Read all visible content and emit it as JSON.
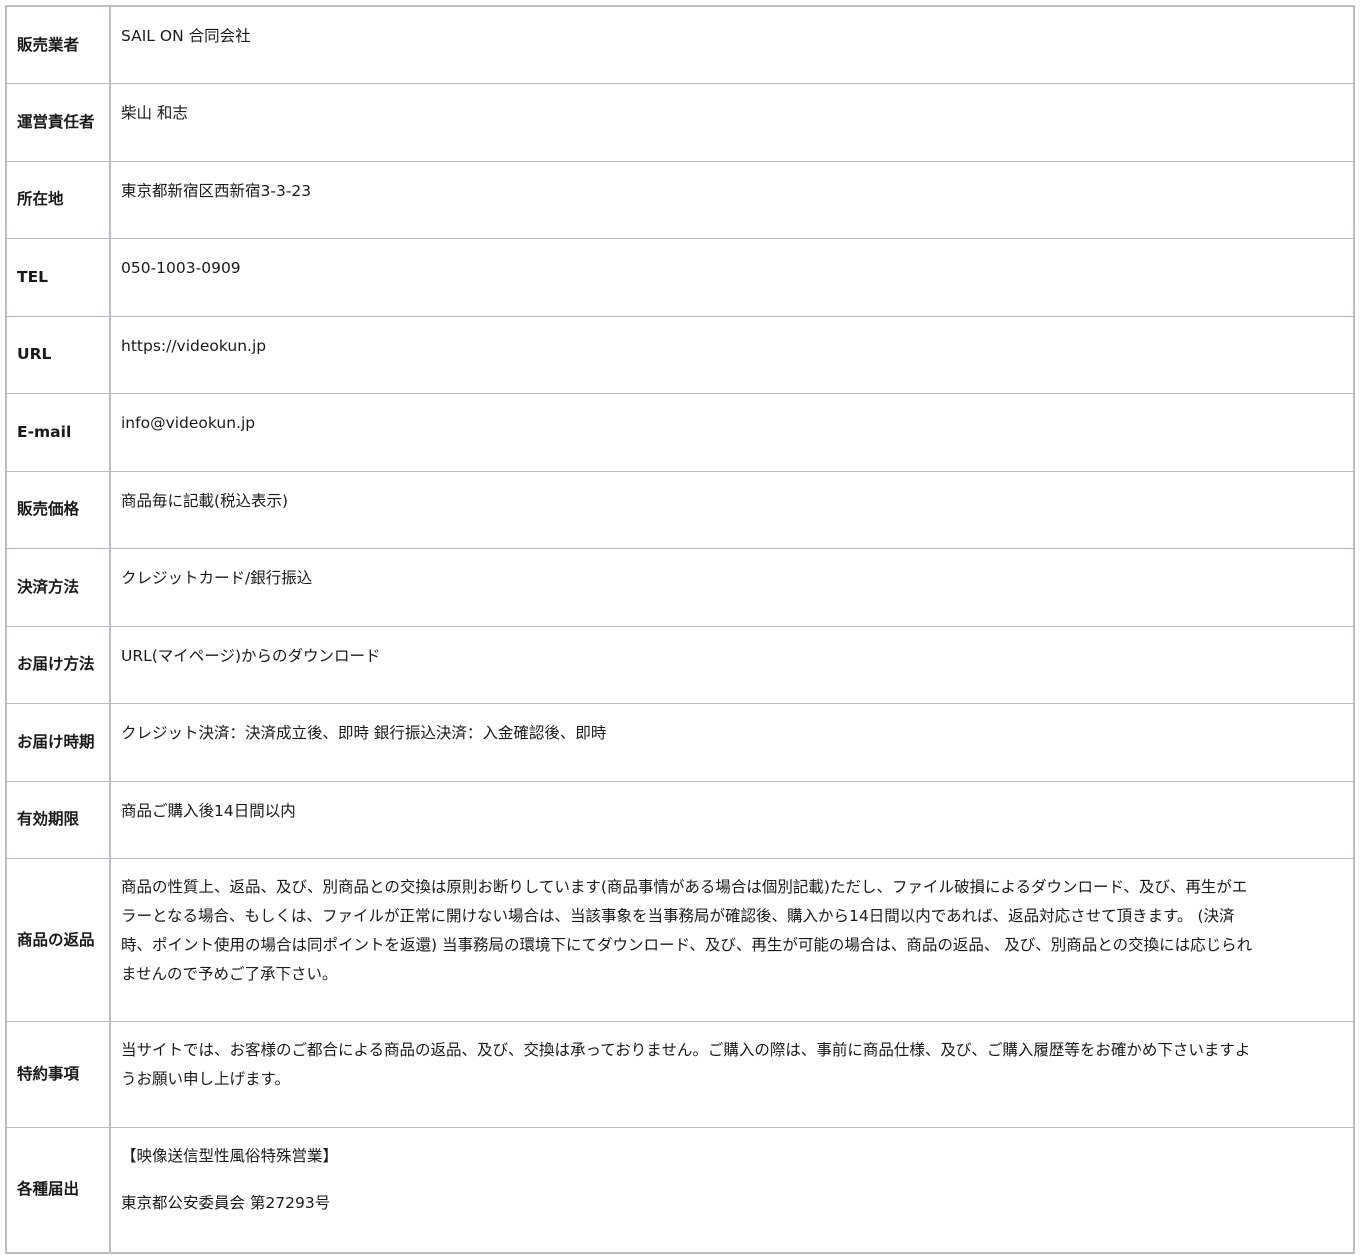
{
  "rows": [
    {
      "label": "販売業者",
      "value": "SAIL ON 合同会社"
    },
    {
      "label": "運営責任者",
      "value": "柴山 和志"
    },
    {
      "label": "所在地",
      "value": "東京都新宿区西新宿3-3-23"
    },
    {
      "label": "TEL",
      "value": "050-1003-0909"
    },
    {
      "label": "URL",
      "value": "https://videokun.jp"
    },
    {
      "label": "E-mail",
      "value": "info@videokun.jp"
    },
    {
      "label": "販売価格",
      "value": "商品毎に記載(税込表示)"
    },
    {
      "label": "決済方法",
      "value": "クレジットカード/銀行振込"
    },
    {
      "label": "お届け方法",
      "value": "URL(マイページ)からのダウンロード"
    },
    {
      "label": "お届け時期",
      "value": "クレジット決済：決済成立後、即時 銀行振込決済：入金確認後、即時"
    },
    {
      "label": "有効期限",
      "value": "商品ご購入後14日間以内"
    },
    {
      "label": "商品の返品",
      "lines": [
        "商品の性質上、返品、及び、別商品との交換は原則お断りしています(商品事情がある場合は個別記載)ただし、ファイル破損によるダウンロード、及び、再生がエ",
        "ラーとなる場合、もしくは、ファイルが正常に開けない場合は、当該事象を当事務局が確認後、購入から14日間以内であれば、返品対応させて頂きます。 (決済",
        "時、ポイント使用の場合は同ポイントを返還) 当事務局の環境下にてダウンロード、及び、再生が可能の場合は、商品の返品、 及び、別商品との交換には応じられ",
        "ませんので予めご了承下さい。"
      ]
    },
    {
      "label": "特約事項",
      "lines": [
        "当サイトでは、お客様のご都合による商品の返品、及び、交換は承っておりません。ご購入の際は、事前に商品仕様、及び、ご購入履歴等をお確かめ下さいますよ",
        "うお願い申し上げます。"
      ]
    },
    {
      "label": "各種届出",
      "paragraphs": [
        "【映像送信型性風俗特殊営業】",
        "東京都公安委員会 第27293号"
      ]
    }
  ]
}
